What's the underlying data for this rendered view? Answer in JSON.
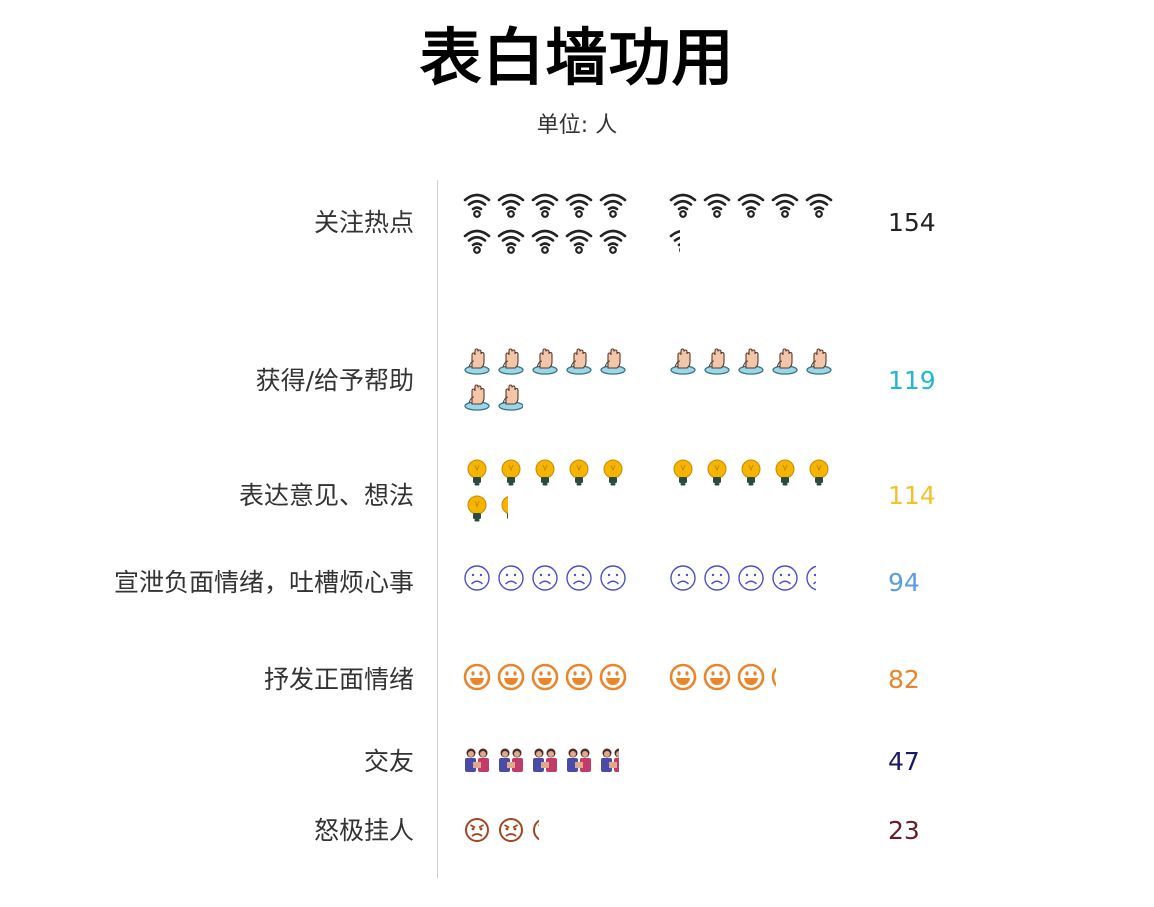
{
  "chart_data": {
    "type": "pictorial-bar",
    "title": "表白墙功用",
    "subtitle": "单位: 人",
    "icon_unit": 10,
    "categories": [
      {
        "label": "关注热点",
        "value": 154,
        "icon": "wifi-icon",
        "color": "#222222",
        "value_color": "#222222"
      },
      {
        "label": "获得/给予帮助",
        "value": 119,
        "icon": "help-hand-icon",
        "color": "#c99a7a",
        "value_color": "#1fb8cf"
      },
      {
        "label": "表达意见、想法",
        "value": 114,
        "icon": "lightbulb-icon",
        "color": "#f5b400",
        "value_color": "#f3c12e"
      },
      {
        "label": "宣泄负面情绪，吐槽烦心事",
        "value": 94,
        "icon": "sad-face-icon",
        "color": "#4a50c8",
        "value_color": "#5a9be3"
      },
      {
        "label": "抒发正面情绪",
        "value": 82,
        "icon": "smile-face-icon",
        "color": "#e7862a",
        "value_color": "#e7862a"
      },
      {
        "label": "交友",
        "value": 47,
        "icon": "friends-icon",
        "color": "#b0355a",
        "value_color": "#1a1868"
      },
      {
        "label": "怒极挂人",
        "value": 23,
        "icon": "angry-face-icon",
        "color": "#a34520",
        "value_color": "#6b1a2a"
      }
    ]
  }
}
